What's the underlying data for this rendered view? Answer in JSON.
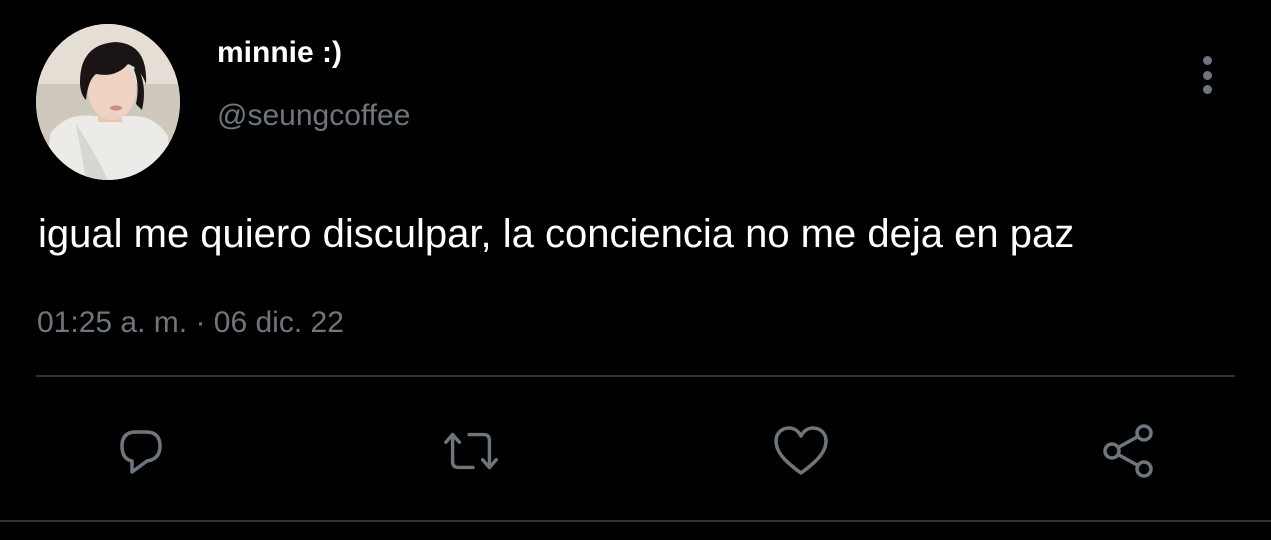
{
  "author": {
    "display_name": "minnie :)",
    "handle": "@seungcoffee"
  },
  "tweet": {
    "text": "igual me quiero disculpar, la conciencia no me deja en paz",
    "time": "01:25 a. m.",
    "separator": "·",
    "date": "06 dic. 22"
  },
  "actions": {
    "reply_icon": "reply-icon",
    "retweet_icon": "retweet-icon",
    "like_icon": "heart-icon",
    "share_icon": "share-icon"
  },
  "colors": {
    "background": "#000000",
    "primary_text": "#ffffff",
    "secondary_text": "#6e767d",
    "divider": "#2f3336"
  }
}
